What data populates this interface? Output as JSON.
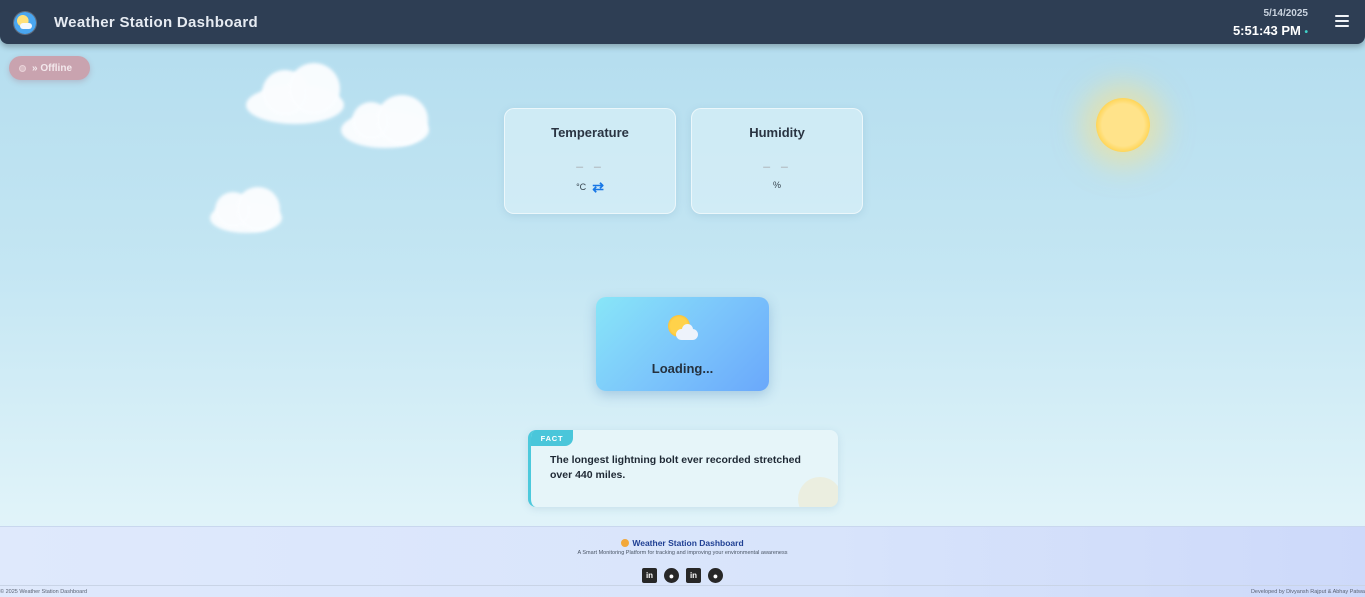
{
  "header": {
    "title": "Weather Station Dashboard",
    "date": "5/14/2025",
    "time": "5:51:43 PM",
    "logo_icon": "weather-logo-icon",
    "menu_icon": "hamburger-menu-icon",
    "background_color": "#2e3e54"
  },
  "status": {
    "label": "» Offline",
    "color": "#c9a3af"
  },
  "cards": {
    "temperature": {
      "title": "Temperature",
      "value": "– –",
      "unit": "°C",
      "toggle_icon": "swap-arrows-icon"
    },
    "humidity": {
      "title": "Humidity",
      "value": "– –",
      "unit": "%"
    }
  },
  "loading": {
    "text": "Loading...",
    "icon": "sun-behind-cloud-icon"
  },
  "fact": {
    "badge": "FACT",
    "text": "The longest lightning bolt ever recorded stretched over 440 miles.",
    "accent_color": "#4ac6da"
  },
  "footer": {
    "title": "Weather Station Dashboard",
    "tagline": "A Smart Monitoring Platform for tracking and improving your environmental awareness",
    "social": [
      {
        "icon": "linkedin-icon",
        "glyph": "in"
      },
      {
        "icon": "github-icon",
        "glyph": "●"
      },
      {
        "icon": "linkedin-icon",
        "glyph": "in"
      },
      {
        "icon": "github-icon",
        "glyph": "●"
      }
    ],
    "copyright": "© 2025 Weather Station Dashboard",
    "developed_by": "Developed by Divyansh Rajput & Abhay Patwa"
  }
}
